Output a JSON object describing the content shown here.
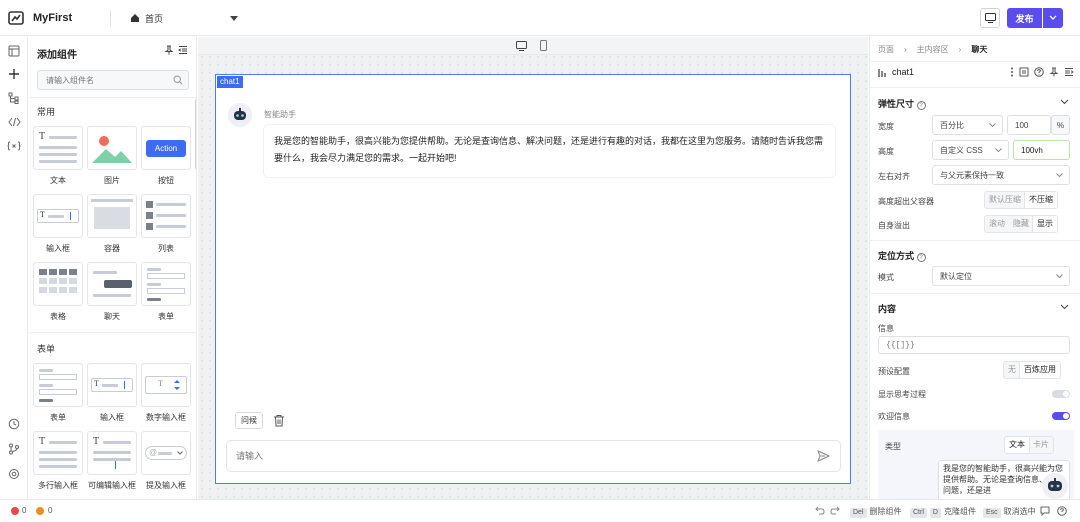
{
  "app": {
    "title": "MyFirst",
    "page_name": "首页"
  },
  "topbar": {
    "publish_label": "发布"
  },
  "left_panel": {
    "title": "添加组件",
    "search_placeholder": "请输入组件名",
    "sections": [
      {
        "label": "常用",
        "items": [
          "文本",
          "图片",
          "按钮",
          "输入框",
          "容器",
          "列表",
          "表格",
          "聊天",
          "表单"
        ]
      },
      {
        "label": "表单",
        "items": [
          "表单",
          "输入框",
          "数字输入框",
          "多行输入框",
          "可编辑输入框",
          "提及输入框"
        ]
      }
    ],
    "button_preview_label": "Action"
  },
  "canvas": {
    "frame_tag": "chat1",
    "bot_name": "智能助手",
    "welcome_message": "我是您的智能助手，很高兴能为您提供帮助。无论是查询信息、解决问题，还是进行有趣的对话，我都在这里为您服务。请随时告诉我您需要什么，我会尽力满足您的需求。一起开始吧!",
    "chip_label": "问候",
    "input_placeholder": "请输入"
  },
  "right_panel": {
    "breadcrumb": [
      "页面",
      "主内容区",
      "聊天"
    ],
    "component_name": "chat1",
    "section_size": "弹性尺寸",
    "width_label": "宽度",
    "width_unit_select": "百分比",
    "width_value": "100",
    "width_unit": "%",
    "height_label": "高度",
    "height_mode": "自定义 CSS",
    "height_value": "100vh",
    "align_label": "左右对齐",
    "align_value": "与父元素保持一致",
    "overflow_label": "高度超出父容器",
    "overflow_options": [
      "默认压缩",
      "不压缩"
    ],
    "self_overflow_label": "自身溢出",
    "self_overflow_options": [
      "滚动",
      "隐藏",
      "显示"
    ],
    "section_position": "定位方式",
    "mode_label": "模式",
    "mode_value": "默认定位",
    "section_content": "内容",
    "info_label": "信息",
    "info_value": "{{[]}}",
    "preset_label": "预设配置",
    "preset_options": [
      "无",
      "百炼应用"
    ],
    "thinking_label": "显示思考过程",
    "welcome_label": "欢迎信息",
    "type_label": "类型",
    "type_options": [
      "文本",
      "卡片"
    ],
    "welcome_preview": "我是您的智能助手，很高兴能为您提供帮助。无论是查询信息、解决问题，还是进"
  },
  "statusbar": {
    "error_count": "0",
    "warning_count": "0",
    "delete_key": "Del",
    "delete_label": "删除组件",
    "clone_key": "Ctrl",
    "clone_key2": "D",
    "clone_label": "克隆组件",
    "esc_key": "Esc",
    "esc_label": "取消选中"
  },
  "colors": {
    "accent": "#5b4cf0",
    "frame": "#3d6cf3",
    "error": "#e5484d",
    "warning": "#f08a24"
  }
}
